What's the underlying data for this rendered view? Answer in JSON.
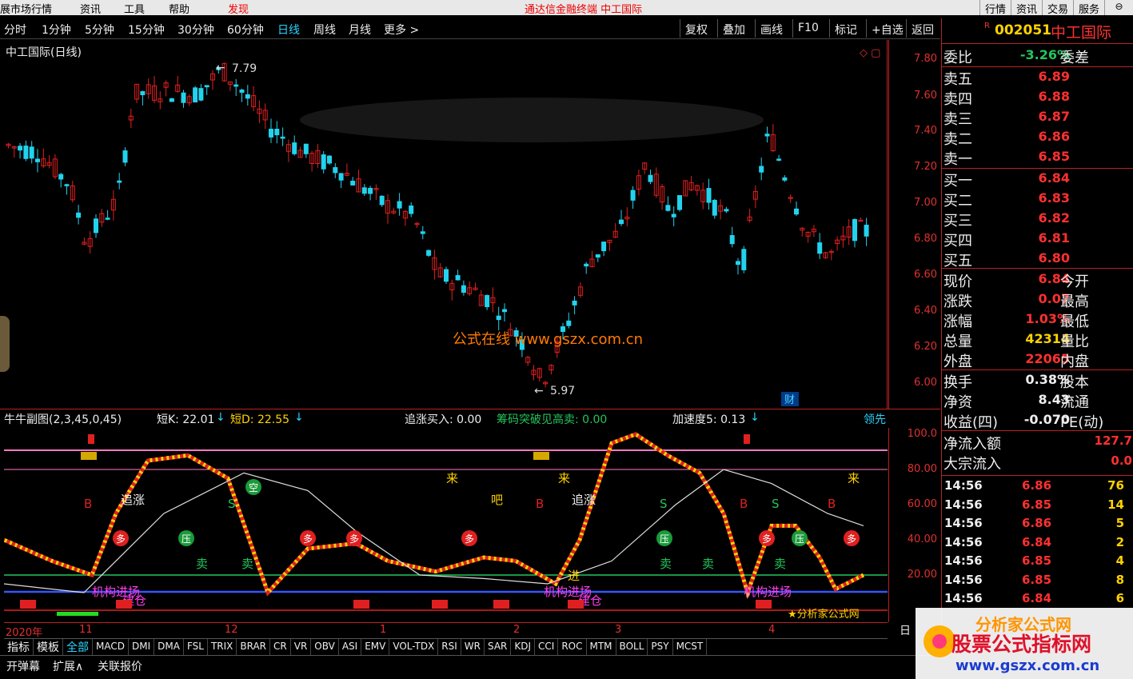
{
  "menu": {
    "items": [
      "展市场行情",
      "资讯",
      "工具",
      "帮助",
      "发现"
    ],
    "center_title": "通达信金融终端   中工国际",
    "right_tabs": [
      "行情",
      "资讯",
      "交易",
      "服务"
    ]
  },
  "toolbar": {
    "periods": [
      "分时",
      "1分钟",
      "5分钟",
      "15分钟",
      "30分钟",
      "60分钟",
      "日线",
      "周线",
      "月线",
      "更多 >"
    ],
    "active_period": "日线",
    "buttons": [
      "复权",
      "叠加",
      "画线",
      "F10",
      "标记",
      "+自选",
      "返回"
    ]
  },
  "main_chart": {
    "title": "中工国际(日线)",
    "high_label": "7.79",
    "low_label": "5.97",
    "watermark": "公式在线   www.gszx.com.cn",
    "fin_badge": "财",
    "price_ticks": [
      "7.80",
      "7.60",
      "7.40",
      "7.20",
      "7.00",
      "6.80",
      "6.60",
      "6.40",
      "6.20",
      "6.00"
    ]
  },
  "sub_header": {
    "name": "牛牛副图(2,3,45,0,45)",
    "k_label": "短K: 22.01",
    "d_label": "短D: 22.55",
    "chase": "追涨买入: 0.00",
    "breakout": "筹码突破见高卖: 0.00",
    "accel": "加速度5: 0.13",
    "lead": "领先"
  },
  "sub_chart": {
    "ticks": [
      "100.0",
      "80.00",
      "60.00",
      "40.00",
      "20.00"
    ],
    "watermark": "★分析家公式网",
    "labels": {
      "chase": "追涨",
      "buy": "B",
      "sell": "S",
      "more": "多",
      "press": "压",
      "empty": "空",
      "come": "来",
      "eat": "吧",
      "sell_arrow": "卖",
      "inst_in": "机构进场",
      "build": "建仓",
      "enter": "进"
    }
  },
  "dates": [
    "2020年",
    "11",
    "12",
    "1",
    "2",
    "3",
    "4"
  ],
  "date_right": "日",
  "indicators": [
    "指标",
    "模板",
    "全部",
    "MACD",
    "DMI",
    "DMA",
    "FSL",
    "TRIX",
    "BRAR",
    "CR",
    "VR",
    "OBV",
    "ASI",
    "EMV",
    "VOL-TDX",
    "RSI",
    "WR",
    "SAR",
    "KDJ",
    "CCI",
    "ROC",
    "MTM",
    "BOLL",
    "PSY",
    "MCST"
  ],
  "active_indicator": "全部",
  "status": [
    "开弹幕",
    "扩展∧",
    "关联报价"
  ],
  "quote": {
    "code": "002051",
    "name": "中工国际",
    "commission_ratio_label": "委比",
    "commission_ratio": "-3.26%",
    "commission_diff_label": "委差",
    "asks": [
      {
        "label": "卖五",
        "price": "6.89"
      },
      {
        "label": "卖四",
        "price": "6.88"
      },
      {
        "label": "卖三",
        "price": "6.87"
      },
      {
        "label": "卖二",
        "price": "6.86"
      },
      {
        "label": "卖一",
        "price": "6.85"
      }
    ],
    "bids": [
      {
        "label": "买一",
        "price": "6.84"
      },
      {
        "label": "买二",
        "price": "6.83"
      },
      {
        "label": "买三",
        "price": "6.82"
      },
      {
        "label": "买四",
        "price": "6.81"
      },
      {
        "label": "买五",
        "price": "6.80"
      }
    ],
    "stats": [
      {
        "label": "现价",
        "value": "6.84",
        "label2": "今开",
        "color": "#ff3030"
      },
      {
        "label": "涨跌",
        "value": "0.07",
        "label2": "最高",
        "color": "#ff3030"
      },
      {
        "label": "涨幅",
        "value": "1.03%",
        "label2": "最低",
        "color": "#ff3030"
      },
      {
        "label": "总量",
        "value": "42314",
        "label2": "量比",
        "color": "#ffd200"
      },
      {
        "label": "外盘",
        "value": "22065",
        "label2": "内盘",
        "color": "#ff3030"
      }
    ],
    "stats2": [
      {
        "label": "换手",
        "value": "0.38%",
        "label2": "股本",
        "color": "#eee"
      },
      {
        "label": "净资",
        "value": "8.43",
        "label2": "流通",
        "color": "#eee"
      },
      {
        "label": "收益(四)",
        "value": "-0.070",
        "label2": "PE(动)",
        "color": "#eee"
      }
    ],
    "flow": [
      {
        "label": "净流入额",
        "value": "127.7"
      },
      {
        "label": "大宗流入",
        "value": "0.0"
      }
    ],
    "ticks": [
      {
        "time": "14:56",
        "price": "6.86",
        "vol": "76"
      },
      {
        "time": "14:56",
        "price": "6.85",
        "vol": "14"
      },
      {
        "time": "14:56",
        "price": "6.86",
        "vol": "5"
      },
      {
        "time": "14:56",
        "price": "6.84",
        "vol": "2"
      },
      {
        "time": "14:56",
        "price": "6.85",
        "vol": "4"
      },
      {
        "time": "14:56",
        "price": "6.85",
        "vol": "8"
      },
      {
        "time": "14:56",
        "price": "6.84",
        "vol": "6"
      }
    ]
  },
  "brand": {
    "name": "股票公式指标网",
    "url": "www.gszx.com.cn",
    "sub": "分析家公式网"
  },
  "colors": {
    "up": "#e02020",
    "down": "#22d3ee",
    "axis": "#b22222",
    "price_red": "#ff3030",
    "volume_yellow": "#ffd200",
    "green": "#22c55e"
  }
}
